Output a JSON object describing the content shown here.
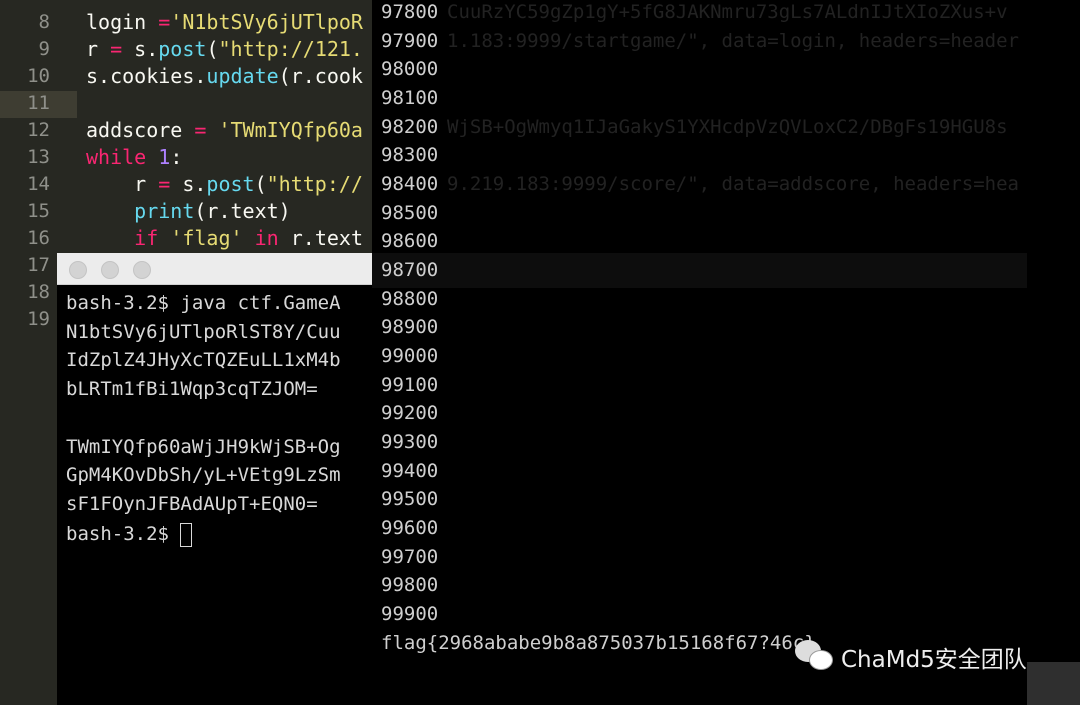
{
  "editor": {
    "line_numbers": [
      "8",
      "9",
      "10",
      "11",
      "12",
      "13",
      "14",
      "15",
      "16",
      "17",
      "18",
      "19"
    ],
    "lines": [
      [
        {
          "t": "login ",
          "c": ""
        },
        {
          "t": "=",
          "c": "kw"
        },
        {
          "t": "'N1btSVy6jUTlpoR",
          "c": "str"
        }
      ],
      [
        {
          "t": "r ",
          "c": ""
        },
        {
          "t": "=",
          "c": "kw"
        },
        {
          "t": " s.",
          "c": ""
        },
        {
          "t": "post",
          "c": "fn"
        },
        {
          "t": "(",
          "c": ""
        },
        {
          "t": "\"http://121.",
          "c": "str"
        }
      ],
      [
        {
          "t": "s.cookies.",
          "c": ""
        },
        {
          "t": "update",
          "c": "fn"
        },
        {
          "t": "(r.cook",
          "c": ""
        }
      ],
      [],
      [
        {
          "t": "addscore ",
          "c": ""
        },
        {
          "t": "=",
          "c": "kw"
        },
        {
          "t": " ",
          "c": ""
        },
        {
          "t": "'TWmIYQfp60a",
          "c": "str"
        }
      ],
      [
        {
          "t": "while",
          "c": "kw"
        },
        {
          "t": " ",
          "c": ""
        },
        {
          "t": "1",
          "c": "num"
        },
        {
          "t": ":",
          "c": ""
        }
      ],
      [
        {
          "t": "    r ",
          "c": ""
        },
        {
          "t": "=",
          "c": "kw"
        },
        {
          "t": " s.",
          "c": ""
        },
        {
          "t": "post",
          "c": "fn"
        },
        {
          "t": "(",
          "c": ""
        },
        {
          "t": "\"http://",
          "c": "str"
        }
      ],
      [
        {
          "t": "    ",
          "c": ""
        },
        {
          "t": "print",
          "c": "fn"
        },
        {
          "t": "(r.text)",
          "c": ""
        }
      ],
      [
        {
          "t": "    ",
          "c": ""
        },
        {
          "t": "if",
          "c": "kw"
        },
        {
          "t": " ",
          "c": ""
        },
        {
          "t": "'flag'",
          "c": "str"
        },
        {
          "t": " ",
          "c": ""
        },
        {
          "t": "in",
          "c": "kw"
        },
        {
          "t": " r.text",
          "c": ""
        }
      ]
    ]
  },
  "terminal": {
    "lines": [
      "bash-3.2$ java ctf.GameA",
      "N1btSVy6jUTlpoRlST8Y/Cuu",
      "IdZplZ4JHyXcTQZEuLL1xM4b",
      "bLRTm1fBi1Wqp3cqTZJOM=",
      "",
      "TWmIYQfp60aWjJH9kWjSB+Og",
      "GpM4KOvDbSh/yL+VEtg9LzSm",
      "sF1FOynJFBAdAUpT+EQN0="
    ],
    "prompt": "bash-3.2$ "
  },
  "output": {
    "lines": [
      "97800",
      "97900",
      "98000",
      "98100",
      "98200",
      "98300",
      "98400",
      "98500",
      "98600",
      "98700",
      "98800",
      "98900",
      "99000",
      "99100",
      "99200",
      "99300",
      "99400",
      "99500",
      "99600",
      "99700",
      "99800",
      "99900"
    ],
    "flag": "flag{2968ababe9b8a875037b15168f67?46c}",
    "ghost": [
      "CuuRzYC59gZp1gY+5fG8JAKNmru73gLs7ALdnIJtXIoZXus+v",
      "1.183:9999/startgame/\", data=login, headers=header",
      "WjSB+OgWmyq1IJaGakyS1YXHcdpVzQVLoxC2/DBgFs19HGU8s",
      "9.219.183:9999/score/\", data=addscore, headers=hea"
    ]
  },
  "watermark": {
    "text": "ChaMd5安全团队"
  }
}
